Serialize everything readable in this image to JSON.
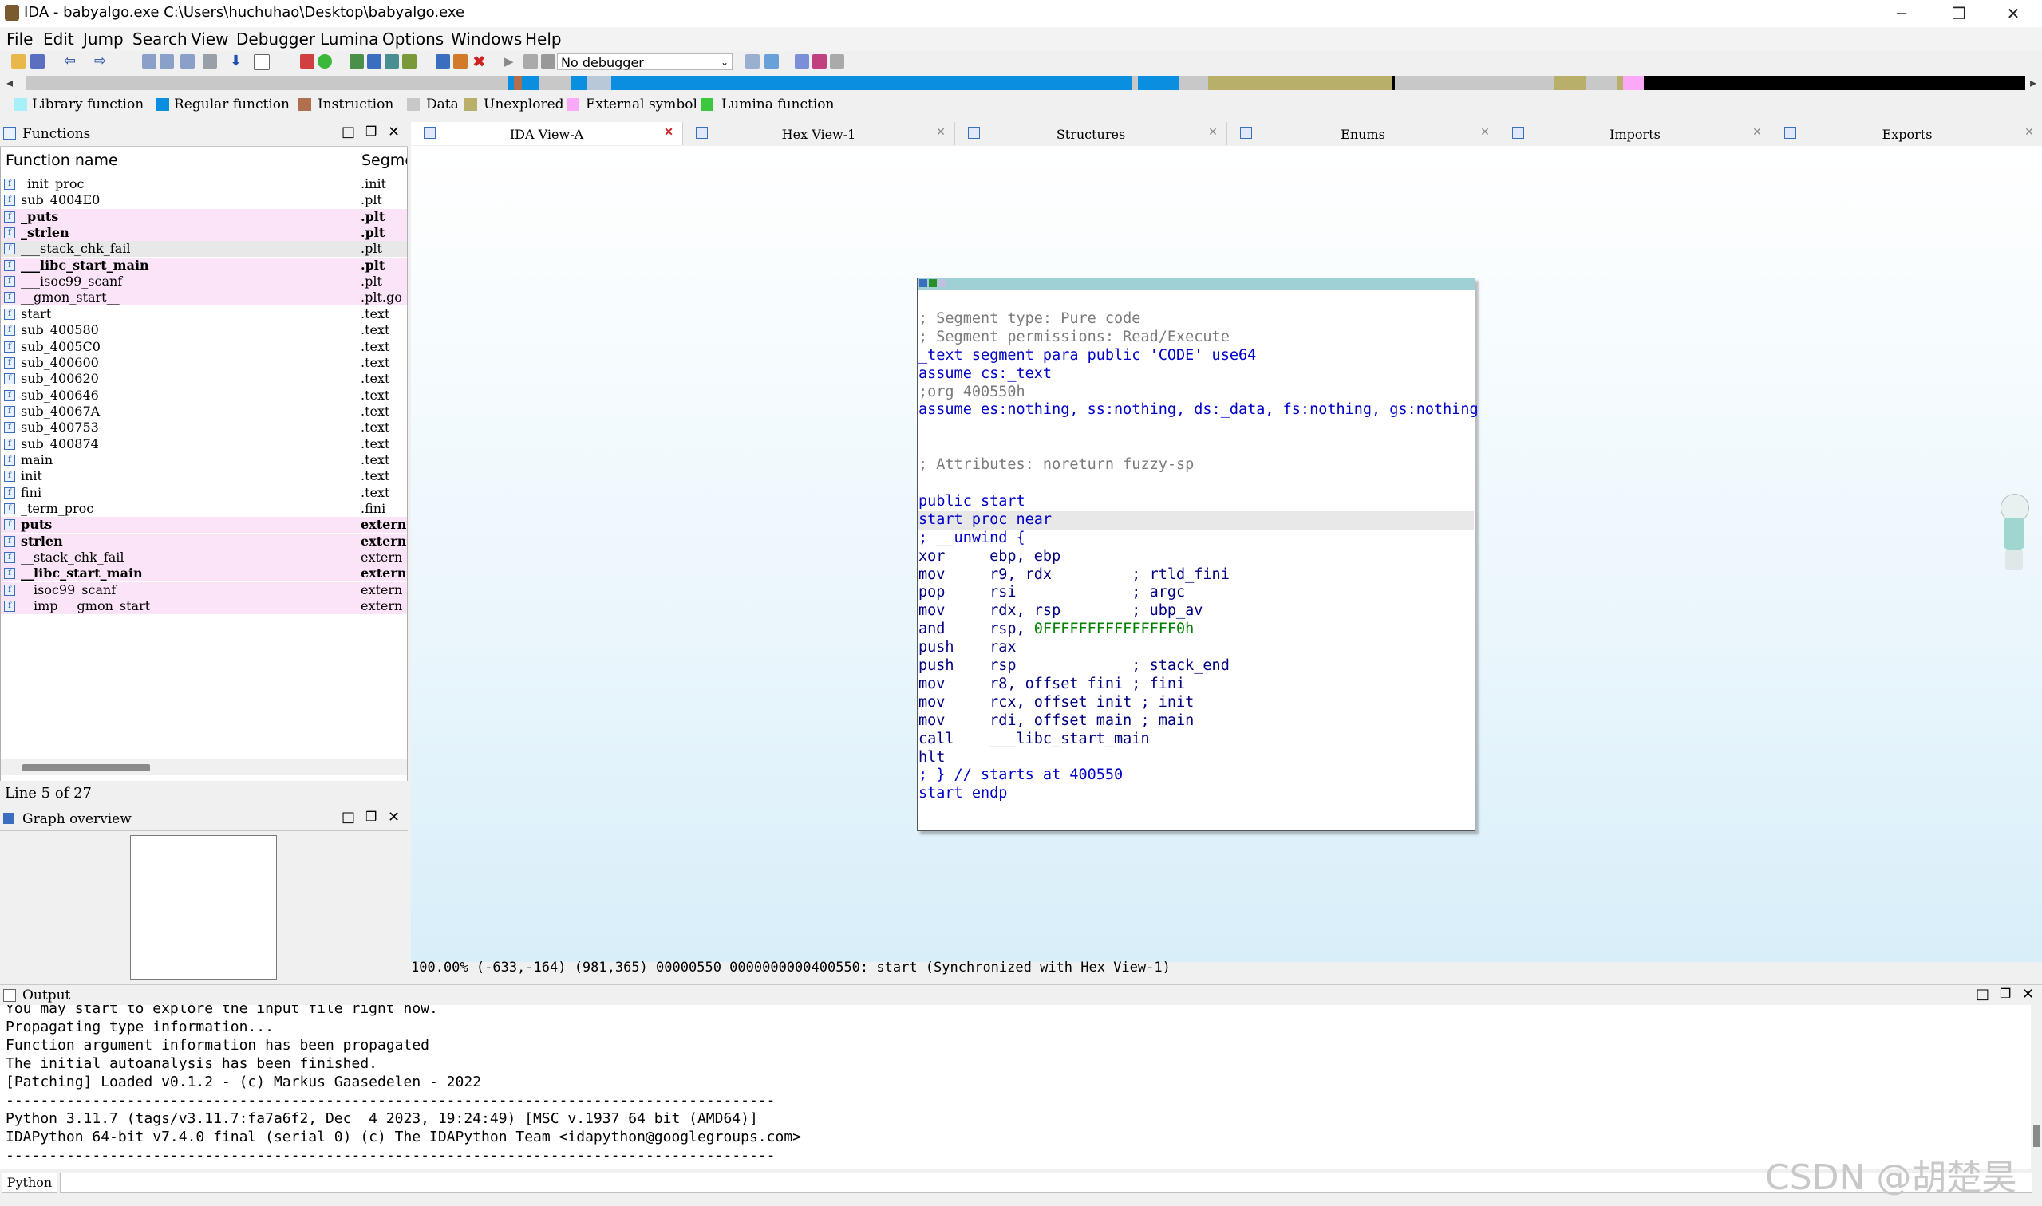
{
  "window": {
    "title": "IDA - babyalgo.exe C:\\Users\\huchuhao\\Desktop\\babyalgo.exe"
  },
  "menu": [
    "File",
    "Edit",
    "Jump",
    "Search",
    "View",
    "Debugger",
    "Lumina",
    "Options",
    "Windows",
    "Help"
  ],
  "toolbar": {
    "debugger_select": "No debugger"
  },
  "legend": [
    {
      "label": "Library function",
      "color": "#a8f0f8"
    },
    {
      "label": "Regular function",
      "color": "#0a8fe0"
    },
    {
      "label": "Instruction",
      "color": "#b0704e"
    },
    {
      "label": "Data",
      "color": "#c8c8c8"
    },
    {
      "label": "Unexplored",
      "color": "#b8b06a"
    },
    {
      "label": "External symbol",
      "color": "#fca8f8"
    },
    {
      "label": "Lumina function",
      "color": "#3cc83c"
    }
  ],
  "functions_panel": {
    "title": "Functions",
    "col_name": "Function name",
    "col_segment": "Segme",
    "status": "Line 5 of 27",
    "rows": [
      {
        "name": "_init_proc",
        "segment": ".init",
        "pink": false,
        "bold": false
      },
      {
        "name": "sub_4004E0",
        "segment": ".plt",
        "pink": false,
        "bold": false
      },
      {
        "name": "_puts",
        "segment": ".plt",
        "pink": true,
        "bold": true
      },
      {
        "name": "_strlen",
        "segment": ".plt",
        "pink": true,
        "bold": true
      },
      {
        "name": "___stack_chk_fail",
        "segment": ".plt",
        "pink": true,
        "bold": false
      },
      {
        "name": "___libc_start_main",
        "segment": ".plt",
        "pink": true,
        "bold": true
      },
      {
        "name": "___isoc99_scanf",
        "segment": ".plt",
        "pink": true,
        "bold": false
      },
      {
        "name": "__gmon_start__",
        "segment": ".plt.go",
        "pink": true,
        "bold": false
      },
      {
        "name": "start",
        "segment": ".text",
        "pink": false,
        "bold": false
      },
      {
        "name": "sub_400580",
        "segment": ".text",
        "pink": false,
        "bold": false
      },
      {
        "name": "sub_4005C0",
        "segment": ".text",
        "pink": false,
        "bold": false
      },
      {
        "name": "sub_400600",
        "segment": ".text",
        "pink": false,
        "bold": false
      },
      {
        "name": "sub_400620",
        "segment": ".text",
        "pink": false,
        "bold": false
      },
      {
        "name": "sub_400646",
        "segment": ".text",
        "pink": false,
        "bold": false
      },
      {
        "name": "sub_40067A",
        "segment": ".text",
        "pink": false,
        "bold": false
      },
      {
        "name": "sub_400753",
        "segment": ".text",
        "pink": false,
        "bold": false
      },
      {
        "name": "sub_400874",
        "segment": ".text",
        "pink": false,
        "bold": false
      },
      {
        "name": "main",
        "segment": ".text",
        "pink": false,
        "bold": false
      },
      {
        "name": "init",
        "segment": ".text",
        "pink": false,
        "bold": false
      },
      {
        "name": "fini",
        "segment": ".text",
        "pink": false,
        "bold": false
      },
      {
        "name": "_term_proc",
        "segment": ".fini",
        "pink": false,
        "bold": false
      },
      {
        "name": "puts",
        "segment": "extern",
        "pink": true,
        "bold": true
      },
      {
        "name": "strlen",
        "segment": "extern",
        "pink": true,
        "bold": true
      },
      {
        "name": "__stack_chk_fail",
        "segment": "extern",
        "pink": true,
        "bold": false
      },
      {
        "name": "__libc_start_main",
        "segment": "extern",
        "pink": true,
        "bold": true
      },
      {
        "name": "__isoc99_scanf",
        "segment": "extern",
        "pink": true,
        "bold": false
      },
      {
        "name": "__imp___gmon_start__",
        "segment": "extern",
        "pink": true,
        "bold": false
      }
    ]
  },
  "graph_overview": {
    "title": "Graph overview"
  },
  "tabs": [
    {
      "label": "IDA View-A",
      "active": true
    },
    {
      "label": "Hex View-1",
      "active": false
    },
    {
      "label": "Structures",
      "active": false
    },
    {
      "label": "Enums",
      "active": false
    },
    {
      "label": "Imports",
      "active": false
    },
    {
      "label": "Exports",
      "active": false
    }
  ],
  "code_lines": [
    {
      "text": "",
      "cls": ""
    },
    {
      "text": "; Segment type: Pure code",
      "cls": "c-gray"
    },
    {
      "text": "; Segment permissions: Read/Execute",
      "cls": "c-gray"
    },
    {
      "text": "_text segment para public 'CODE' use64",
      "cls": "c-blue"
    },
    {
      "text": "assume cs:_text",
      "cls": "c-blue"
    },
    {
      "text": ";org 400550h",
      "cls": "c-gray"
    },
    {
      "text": "assume es:nothing, ss:nothing, ds:_data, fs:nothing, gs:nothing",
      "cls": "c-blue"
    },
    {
      "text": "",
      "cls": ""
    },
    {
      "text": "",
      "cls": ""
    },
    {
      "text": "; Attributes: noreturn fuzzy-sp",
      "cls": "c-gray"
    },
    {
      "text": "",
      "cls": ""
    },
    {
      "text": "public start",
      "cls": "c-blue"
    },
    {
      "text": "start proc near",
      "cls": "c-blue"
    },
    {
      "text": "; __unwind {",
      "cls": "c-blue"
    },
    {
      "text": "xor     ebp, ebp",
      "cls": "c-navy"
    },
    {
      "text": "mov     r9, rdx         ; rtld_fini",
      "cls": "c-navy"
    },
    {
      "text": "pop     rsi             ; argc",
      "cls": "c-navy"
    },
    {
      "text": "mov     rdx, rsp        ; ubp_av",
      "cls": "c-navy"
    },
    {
      "text": "and     rsp, 0FFFFFFFFFFFFFFF0h",
      "cls": "c-navy"
    },
    {
      "text": "push    rax",
      "cls": "c-navy"
    },
    {
      "text": "push    rsp             ; stack_end",
      "cls": "c-navy"
    },
    {
      "text": "mov     r8, offset fini ; fini",
      "cls": "c-navy"
    },
    {
      "text": "mov     rcx, offset init ; init",
      "cls": "c-navy"
    },
    {
      "text": "mov     rdi, offset main ; main",
      "cls": "c-navy"
    },
    {
      "text": "call    ___libc_start_main",
      "cls": "c-navy"
    },
    {
      "text": "hlt",
      "cls": "c-navy"
    },
    {
      "text": "; } // starts at 400550",
      "cls": "c-blue"
    },
    {
      "text": "start endp",
      "cls": "c-blue"
    }
  ],
  "graph_status": "100.00% (-633,-164) (981,365) 00000550 0000000000400550: start (Synchronized with Hex View-1)",
  "output": {
    "title": "Output",
    "lines": [
      "You may start to explore the input file right now.",
      "Propagating type information...",
      "Function argument information has been propagated",
      "The initial autoanalysis has been finished.",
      "[Patching] Loaded v0.1.2 - (c) Markus Gaasedelen - 2022",
      "-----------------------------------------------------------------------------------------",
      "Python 3.11.7 (tags/v3.11.7:fa7a6f2, Dec  4 2023, 19:24:49) [MSC v.1937 64 bit (AMD64)]",
      "IDAPython 64-bit v7.4.0 final (serial 0) (c) The IDAPython Team <idapython@googlegroups.com>",
      "-----------------------------------------------------------------------------------------"
    ],
    "python_button": "Python"
  },
  "watermark": "CSDN @胡楚昊"
}
